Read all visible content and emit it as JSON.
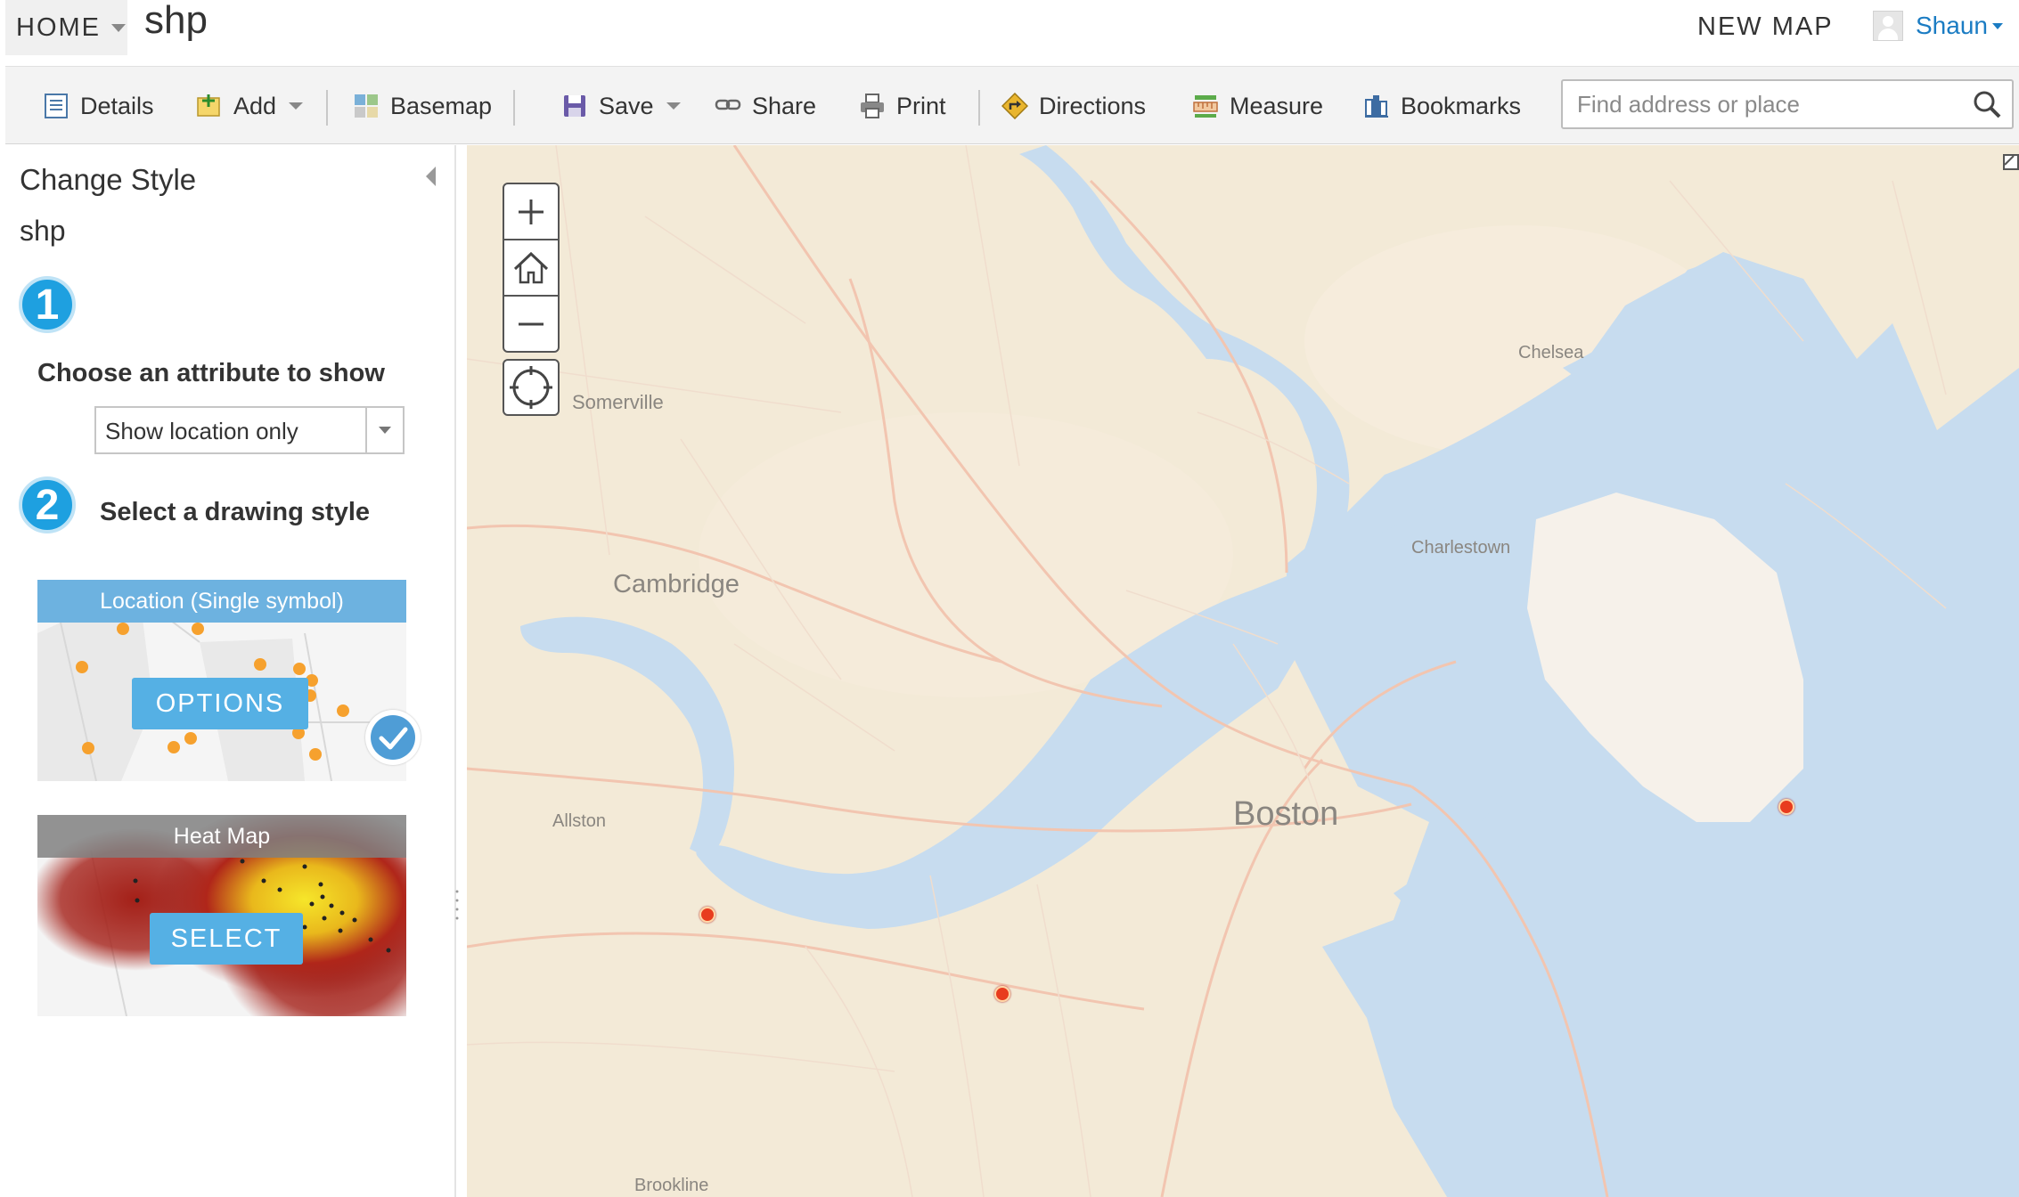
{
  "topbar": {
    "home_label": "HOME",
    "map_title": "shp",
    "new_map_label": "NEW MAP",
    "user_name": "Shaun"
  },
  "toolbar": {
    "details_label": "Details",
    "add_label": "Add",
    "basemap_label": "Basemap",
    "save_label": "Save",
    "share_label": "Share",
    "print_label": "Print",
    "directions_label": "Directions",
    "measure_label": "Measure",
    "bookmarks_label": "Bookmarks",
    "search_placeholder": "Find address or place"
  },
  "panel": {
    "heading": "Change Style",
    "layer_name": "shp",
    "step1": {
      "number": "1",
      "label": "Choose an attribute to show",
      "selected_value": "Show location only"
    },
    "step2": {
      "number": "2",
      "label": "Select a drawing style"
    },
    "styles": [
      {
        "title": "Location (Single symbol)",
        "button": "OPTIONS",
        "selected": true
      },
      {
        "title": "Heat Map",
        "button": "SELECT",
        "selected": false
      }
    ]
  },
  "map": {
    "places": [
      "Somerville",
      "Chelsea",
      "Charlestown",
      "Cambridge",
      "Boston",
      "Allston",
      "Brookline"
    ],
    "feature_count": 3,
    "colors": {
      "land": "#f3ead7",
      "water": "#c7dcef",
      "airport": "#f6f1ea",
      "marker": "#e83c1e",
      "accent": "#1ea0e0"
    }
  }
}
